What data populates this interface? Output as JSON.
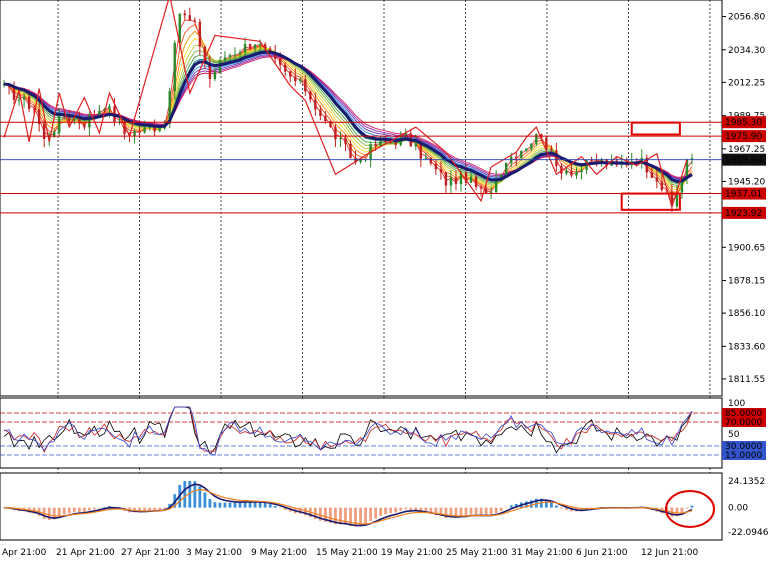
{
  "chart_data": [
    {
      "type": "line",
      "panel": "price",
      "ylim": [
        1800,
        2068
      ],
      "ytick_labels": [
        "2056.80",
        "2034.30",
        "2012.25",
        "1989.75",
        "1967.25",
        "1945.20",
        "1923.45",
        "1900.65",
        "1878.15",
        "1856.10",
        "1833.60",
        "1811.55"
      ],
      "ytick_values": [
        2056.8,
        2034.3,
        2012.25,
        1989.75,
        1967.25,
        1945.2,
        1923.45,
        1900.65,
        1878.15,
        1856.1,
        1833.6,
        1811.55
      ],
      "x_labels": [
        "Apr 21:00",
        "21 Apr 21:00",
        "27 Apr 21:00",
        "3 May 21:00",
        "9 May 21:00",
        "15 May 21:00",
        "19 May 21:00",
        "25 May 21:00",
        "31 May 21:00",
        "6 Jun 21:00",
        "12 Jun 21:00"
      ],
      "n_bars": 138,
      "horizontal_levels": [
        {
          "label": "1985.30",
          "value": 1985.3,
          "color": "#cc0000"
        },
        {
          "label": "1975.90",
          "value": 1975.9,
          "color": "#cc0000"
        },
        {
          "label": "1937.01",
          "value": 1937.01,
          "color": "#cc0000"
        },
        {
          "label": "1923.92",
          "value": 1923.92,
          "color": "#cc0000"
        }
      ],
      "current_price": {
        "label": "1959.94",
        "value": 1959.94
      },
      "close_anchors": [
        [
          0,
          2008
        ],
        [
          6,
          1995
        ],
        [
          8,
          1973
        ],
        [
          12,
          1990
        ],
        [
          16,
          1985
        ],
        [
          20,
          1998
        ],
        [
          24,
          1978
        ],
        [
          28,
          1980
        ],
        [
          32,
          1985
        ],
        [
          35,
          2060
        ],
        [
          38,
          2050
        ],
        [
          41,
          2015
        ],
        [
          44,
          2030
        ],
        [
          50,
          2040
        ],
        [
          56,
          2018
        ],
        [
          60,
          2008
        ],
        [
          64,
          1985
        ],
        [
          70,
          1958
        ],
        [
          74,
          1970
        ],
        [
          80,
          1975
        ],
        [
          84,
          1960
        ],
        [
          88,
          1945
        ],
        [
          92,
          1948
        ],
        [
          96,
          1935
        ],
        [
          100,
          1960
        ],
        [
          104,
          1970
        ],
        [
          107,
          1978
        ],
        [
          110,
          1955
        ],
        [
          114,
          1952
        ],
        [
          118,
          1960
        ],
        [
          122,
          1955
        ],
        [
          126,
          1962
        ],
        [
          130,
          1948
        ],
        [
          133,
          1928
        ],
        [
          136,
          1960
        ],
        [
          137,
          1958
        ]
      ],
      "zigzag": [
        [
          0,
          1975
        ],
        [
          3,
          2007
        ],
        [
          5,
          1972
        ],
        [
          7,
          2008
        ],
        [
          9,
          1972
        ],
        [
          11,
          2005
        ],
        [
          13,
          1982
        ],
        [
          16,
          2002
        ],
        [
          19,
          1978
        ],
        [
          21,
          2005
        ],
        [
          25,
          1976
        ],
        [
          33,
          2071
        ],
        [
          37,
          2005
        ],
        [
          42,
          2044
        ],
        [
          51,
          2040
        ],
        [
          57,
          2010
        ],
        [
          60,
          2000
        ],
        [
          66,
          1950
        ],
        [
          73,
          1965
        ],
        [
          82,
          1982
        ],
        [
          88,
          1965
        ],
        [
          95,
          1932
        ],
        [
          97,
          1955
        ],
        [
          102,
          1965
        ],
        [
          104,
          1975
        ],
        [
          106,
          1982
        ],
        [
          110,
          1950
        ],
        [
          115,
          1962
        ],
        [
          118,
          1950
        ],
        [
          122,
          1962
        ],
        [
          126,
          1956
        ],
        [
          130,
          1964
        ],
        [
          133,
          1928
        ],
        [
          136,
          1960
        ]
      ],
      "ma_color": "#1a1a6e",
      "zigzag_color": "#e02020",
      "boxes": [
        {
          "value_low": 1977,
          "value_high": 1985,
          "bar_start": 125,
          "bar_end": 131
        },
        {
          "value_low": 1926,
          "value_high": 1937,
          "bar_start": 123,
          "bar_end": 131
        }
      ]
    },
    {
      "type": "line",
      "panel": "oscillator",
      "ylim": [
        0,
        100
      ],
      "levels": [
        {
          "label": "85.0000",
          "value": 85,
          "color": "#cc0000"
        },
        {
          "label": "70.0000",
          "value": 70,
          "color": "#cc0000"
        },
        {
          "label": "30.0000",
          "value": 30,
          "color": "#3355cc"
        },
        {
          "label": "15.0000",
          "value": 15,
          "color": "#3355cc"
        }
      ],
      "tick_labels": [
        "100",
        "50"
      ],
      "series_colors": [
        "#000000",
        "#cc2222",
        "#3344cc"
      ]
    },
    {
      "type": "bar",
      "panel": "histogram",
      "ylim": [
        -22.0946,
        24.1352
      ],
      "tick_labels": [
        "24.1352",
        "0.00",
        "-22.0946"
      ],
      "positive_color": "#3a8fd8",
      "negative_color": "#f0a080",
      "signal_colors": [
        "#1a1a6e",
        "#f08020"
      ]
    }
  ]
}
